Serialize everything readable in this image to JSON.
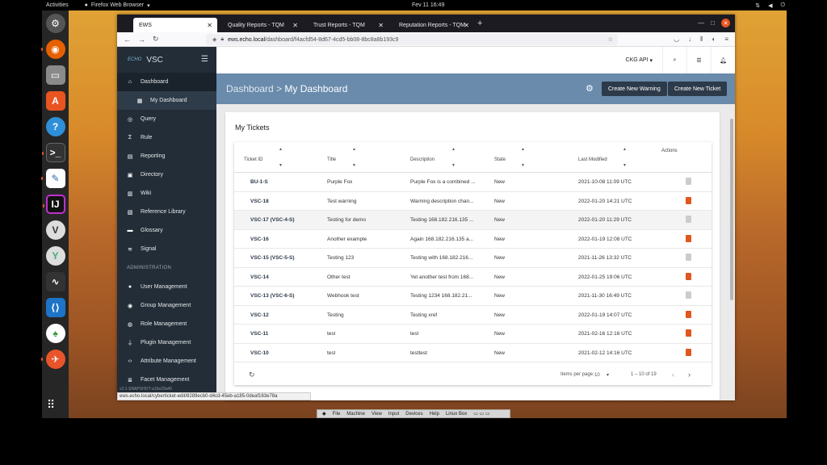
{
  "topbar": {
    "activities": "Activities",
    "app": "Firefox Web Browser",
    "clock": "Fev 11  16:49"
  },
  "browser": {
    "tabs": [
      {
        "label": "EWS",
        "active": true
      },
      {
        "label": "Quality Reports - TQM"
      },
      {
        "label": "Trust Reports - TQM"
      },
      {
        "label": "Reputation Reports - TQM"
      }
    ],
    "url_host": "ews.echo.local",
    "url_path": "/dashboard/f4acfd54-8d67-4cd5-bb08-8bc8a8b193c9"
  },
  "sidebar": {
    "brand_logo": "ECHO",
    "brand": "VSC",
    "items": [
      {
        "label": "Dashboard",
        "icon": "home-icon",
        "sel": true
      },
      {
        "label": "My Dashboard",
        "icon": "grid-icon",
        "sub": true
      },
      {
        "label": "Query",
        "icon": "target-icon"
      },
      {
        "label": "Rule",
        "icon": "sigma-icon"
      },
      {
        "label": "Reporting",
        "icon": "report-icon"
      },
      {
        "label": "Directory",
        "icon": "directory-icon"
      },
      {
        "label": "Wiki",
        "icon": "wiki-icon"
      },
      {
        "label": "Reference Library",
        "icon": "book-icon"
      },
      {
        "label": "Glossary",
        "icon": "glossary-icon"
      },
      {
        "label": "Signal",
        "icon": "wifi-icon"
      }
    ],
    "admin_header": "ADMINISTRATION",
    "admin_items": [
      {
        "label": "User Management",
        "icon": "user-icon"
      },
      {
        "label": "Group Management",
        "icon": "group-icon"
      },
      {
        "label": "Role Management",
        "icon": "globe-icon"
      },
      {
        "label": "Plugin Management",
        "icon": "plug-icon"
      },
      {
        "label": "Attribute Management",
        "icon": "code-icon"
      },
      {
        "label": "Facet Management",
        "icon": "list-icon"
      }
    ],
    "version": "v2.1-SNAPSHOT-a16e29a45"
  },
  "header": {
    "api": "CKG API"
  },
  "banner": {
    "crumb_parent": "Dashboard >",
    "crumb_current": "My Dashboard",
    "warning_btn": "Create New Warning",
    "ticket_btn": "Create New Ticket"
  },
  "card": {
    "title": "My Tickets"
  },
  "table": {
    "columns": [
      "Ticket ID",
      "Title",
      "Description",
      "State",
      "Last Modified",
      "Actions"
    ],
    "rows": [
      {
        "id": "BU-1-S",
        "title": "Purple Fox",
        "desc": "Purple Fox is a combined ...",
        "state": "New",
        "modified": "2021-10-08 11:09 UTC",
        "del": false
      },
      {
        "id": "VSC-18",
        "title": "Test warning",
        "desc": "Warning description chan...",
        "state": "New",
        "modified": "2022-01-20 14:21 UTC",
        "del": true
      },
      {
        "id": "VSC-17 (VSC-4-S)",
        "title": "Testing for demo",
        "desc": "Testing 168.182.216.135 ...",
        "state": "New",
        "modified": "2022-01-20 11:29 UTC",
        "del": false
      },
      {
        "id": "VSC-16",
        "title": "Another example",
        "desc": "Again 168.182.216.135 a...",
        "state": "New",
        "modified": "2022-01-19 12:08 UTC",
        "del": true
      },
      {
        "id": "VSC-15 (VSC-5-S)",
        "title": "Testing 123",
        "desc": "Testing with 168.182.216...",
        "state": "New",
        "modified": "2021-11-26 13:32 UTC",
        "del": false
      },
      {
        "id": "VSC-14",
        "title": "Other test",
        "desc": "Yet another test from 168...",
        "state": "New",
        "modified": "2022-01-25 19:06 UTC",
        "del": true
      },
      {
        "id": "VSC-13 (VSC-6-S)",
        "title": "Webhook test",
        "desc": "Testing 1234 168.182.21...",
        "state": "New",
        "modified": "2021-11-30 16:49 UTC",
        "del": false
      },
      {
        "id": "VSC-12",
        "title": "Testing",
        "desc": "Testing xref",
        "state": "New",
        "modified": "2022-01-19 14:07 UTC",
        "del": true
      },
      {
        "id": "VSC-11",
        "title": "test",
        "desc": "test",
        "state": "New",
        "modified": "2021-02-16 12:16 UTC",
        "del": true
      },
      {
        "id": "VSC-10",
        "title": "test",
        "desc": "testtest",
        "state": "New",
        "modified": "2021-02-12 14:16 UTC",
        "del": true
      }
    ],
    "items_per_page_label": "Items per page:",
    "items_per_page": "10",
    "range": "1 – 10 of 19"
  },
  "statusbar": {
    "url": "ews.echo.local/cyberticket-edit/8289ecb0-d4cd-45eb-a185-0deaf163e78a"
  },
  "vbox": {
    "items": [
      "File",
      "Machine",
      "View",
      "Input",
      "Devices",
      "Help",
      "Linux Box"
    ]
  }
}
